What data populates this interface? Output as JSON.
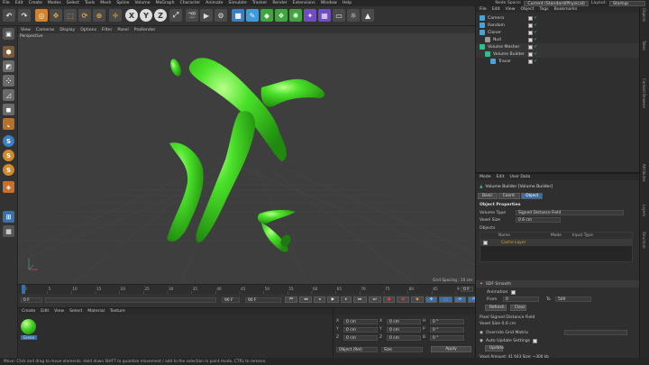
{
  "menu": {
    "items": [
      "File",
      "Edit",
      "Create",
      "Modes",
      "Select",
      "Tools",
      "Mesh",
      "Spline",
      "Volume",
      "MoGraph",
      "Character",
      "Animate",
      "Simulate",
      "Tracker",
      "Render",
      "Extensions",
      "Window",
      "Help"
    ],
    "node_space_label": "Node Space:",
    "node_space_value": "Current (Standard/Physical)",
    "layout_label": "Layout:",
    "layout_value": "Startup"
  },
  "toolbar": {
    "axis_x": "X",
    "axis_y": "Y",
    "axis_z": "Z"
  },
  "viewport": {
    "menu": [
      "View",
      "Cameras",
      "Display",
      "Options",
      "Filter",
      "Panel",
      "ProRender"
    ],
    "camera_label": "Perspective",
    "grid_spacing": "Grid Spacing : 10 cm",
    "colors": {
      "background": "#3e3e3e",
      "grid": "#474747",
      "shape": "#39d21c"
    }
  },
  "timeline": {
    "ticks": [
      "0",
      "5",
      "10",
      "15",
      "20",
      "25",
      "30",
      "35",
      "40",
      "45",
      "50",
      "55",
      "60",
      "65",
      "70",
      "75",
      "80",
      "85",
      "90"
    ],
    "current_frame_box": "0 F",
    "start_frame": "0 F",
    "end_frame": "90 F",
    "preview_end": "90 F",
    "current_frame_marker": 0
  },
  "material_manager": {
    "menu": [
      "Create",
      "Edit",
      "View",
      "Select",
      "Material",
      "Texture"
    ],
    "materials": [
      {
        "name": "Green",
        "color": "#3fcf23"
      }
    ]
  },
  "coordinates": {
    "rows": [
      {
        "axis": "X",
        "pos": "0 cm",
        "axis2": "X",
        "size": "0 cm",
        "rot_axis": "H",
        "rot": "0 °"
      },
      {
        "axis": "Y",
        "pos": "0 cm",
        "axis2": "Y",
        "size": "0 cm",
        "rot_axis": "P",
        "rot": "0 °"
      },
      {
        "axis": "Z",
        "pos": "0 cm",
        "axis2": "Z",
        "size": "0 cm",
        "rot_axis": "B",
        "rot": "0 °"
      }
    ],
    "mode1": "Object (Rel)",
    "mode2": "Size",
    "apply_label": "Apply"
  },
  "object_manager": {
    "menu": [
      "File",
      "Edit",
      "View",
      "Object",
      "Tags",
      "Bookmarks"
    ],
    "objects": [
      {
        "name": "Camera",
        "indent": 0,
        "icon_color": "#4aa3d8"
      },
      {
        "name": "Random",
        "indent": 0,
        "icon_color": "#4aa3d8"
      },
      {
        "name": "Cloner",
        "indent": 0,
        "icon_color": "#4aa3d8"
      },
      {
        "name": "Null",
        "indent": 1,
        "icon_color": "#9a9a9a"
      },
      {
        "name": "Volume Mesher",
        "indent": 0,
        "icon_color": "#2fbf8f"
      },
      {
        "name": "Volume Builder",
        "indent": 1,
        "icon_color": "#2fbf8f"
      },
      {
        "name": "Tracer",
        "indent": 2,
        "icon_color": "#4aa3d8"
      }
    ]
  },
  "attributes": {
    "menu": [
      "Mode",
      "Edit",
      "User Data"
    ],
    "title": "Volume Builder [Volume Builder]",
    "tabs": [
      "Basic",
      "Coord.",
      "Object"
    ],
    "active_tab": "Object",
    "section_title": "Object Properties",
    "volume_type_label": "Volume Type",
    "volume_type_value": "Signed Distance Field",
    "voxel_size_label": "Voxel Size",
    "voxel_size_value": "0.6 cm",
    "objects_label": "Objects",
    "list_headers": [
      "Name",
      "Mode",
      "Input Type"
    ],
    "list_items": [
      "Cache Layer"
    ],
    "sdf_smooth_label": "SDF Smooth",
    "animation_label": "Animation",
    "from_label": "From",
    "from_value": "0",
    "to_label": "To",
    "to_value": "500",
    "refresh_label": "Refresh",
    "clear_label": "Clear",
    "pixel_sdf_label": "Pixel Signed Distance Field",
    "voxel_size_info": "Voxel Size 0.6 cm",
    "override_label": "Override Grid Matrix",
    "auto_update_label": "Auto Update Settings",
    "update_label": "Update",
    "voxel_amount": "Voxel Amount: 41 643   Size: ~300 kb"
  },
  "right_tabs": [
    "Objects",
    "Takes",
    "Content Browser",
    "Attributes",
    "Layers",
    "Structure"
  ],
  "status": {
    "text": "Move: Click and drag to move elements. Hold down SHIFT to quantize movement / add to the selection in point mode, CTRL to remove."
  }
}
